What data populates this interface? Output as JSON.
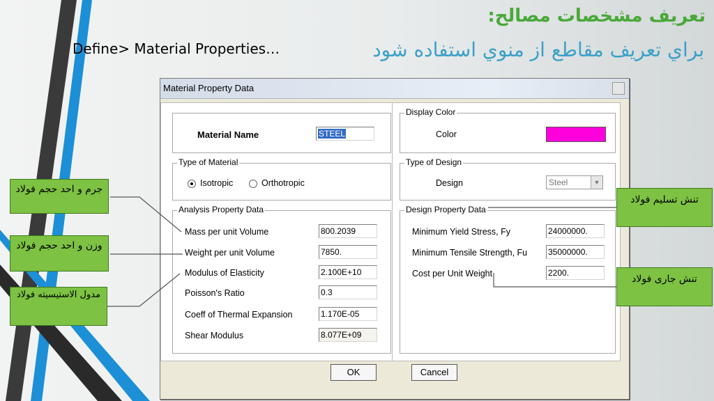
{
  "slide": {
    "title_ar": "تعريف مشخصات مصالح:",
    "subtitle_ar": "براي تعريف مقاطع از منوي استفاده شود",
    "menu_path": "Define> Material Properties…"
  },
  "dialog": {
    "title": "Material Property Data",
    "material_name_label": "Material Name",
    "material_name_value": "STEEL",
    "type_of_material": {
      "label": "Type of Material",
      "isotropic_label": "Isotropic",
      "orthotropic_label": "Orthotropic",
      "selected": "Isotropic"
    },
    "analysis": {
      "label": "Analysis Property Data",
      "rows": [
        {
          "label": "Mass per unit Volume",
          "value": "800.2039"
        },
        {
          "label": "Weight per unit Volume",
          "value": "7850."
        },
        {
          "label": "Modulus of Elasticity",
          "value": "2.100E+10"
        },
        {
          "label": "Poisson's Ratio",
          "value": "0.3"
        },
        {
          "label": "Coeff of Thermal Expansion",
          "value": "1.170E-05"
        },
        {
          "label": "Shear Modulus",
          "value": "8.077E+09"
        }
      ]
    },
    "display_color": {
      "label": "Display Color",
      "color_label": "Color",
      "color": "#ff00dd"
    },
    "type_of_design": {
      "label": "Type of Design",
      "design_label": "Design",
      "design_value": "Steel"
    },
    "design": {
      "label": "Design Property Data",
      "rows": [
        {
          "label": "Minimum Yield Stress, Fy",
          "value": "24000000."
        },
        {
          "label": "Minimum Tensile Strength, Fu",
          "value": "35000000."
        },
        {
          "label": "Cost per Unit Weight",
          "value": "2200."
        }
      ]
    },
    "ok_label": "OK",
    "cancel_label": "Cancel"
  },
  "callouts": {
    "mass": "جرم و احد حجم فولاد",
    "weight": "وزن و احد حجم فولاد",
    "modulus": "مدول الاستيسيته فولاد",
    "yield": "تنش تسليم فولاد",
    "tensile": "تنش جاری فولاد"
  },
  "colors": {
    "callout_green": "#7dc243",
    "title_green": "#4aa83a",
    "subtitle_blue": "#3aa0c8",
    "display_color": "#ff00dd"
  }
}
